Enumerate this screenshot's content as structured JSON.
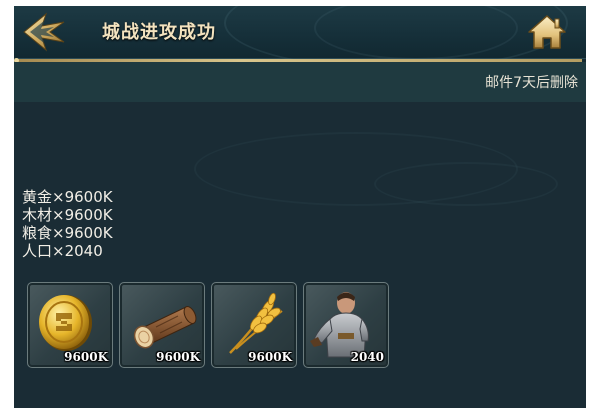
{
  "header": {
    "title": "城战进攻成功"
  },
  "mail": {
    "expire_text": "邮件7天后删除"
  },
  "rewards_text": [
    "黄金×9600K",
    "木材×9600K",
    "粮食×9600K",
    "人口×2040"
  ],
  "items": [
    {
      "icon": "gold-coin-icon",
      "qty": "9600K"
    },
    {
      "icon": "wood-log-icon",
      "qty": "9600K"
    },
    {
      "icon": "wheat-icon",
      "qty": "9600K"
    },
    {
      "icon": "soldier-icon",
      "qty": "2040"
    }
  ],
  "colors": {
    "background": "#1a2c35",
    "header": "#1d3a44",
    "title": "#f3e3bf",
    "gold_accent": "#d8c58c"
  }
}
